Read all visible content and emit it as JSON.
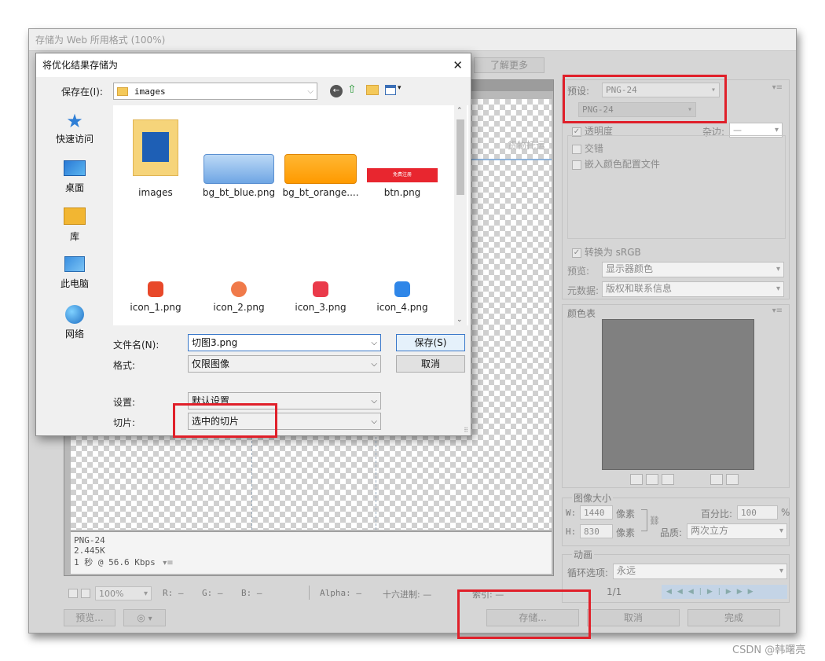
{
  "window": {
    "title": "存储为 Web 所用格式 (100%)",
    "learn_more": "了解更多",
    "canvas_watermark": "货物托运"
  },
  "preview_info": {
    "format": "PNG-24",
    "size": "2.445K",
    "speed": "1 秒 @ 56.6 Kbps"
  },
  "statusbar": {
    "zoom": "100%",
    "r": "R: —",
    "g": "G: —",
    "b": "B: —",
    "alpha": "Alpha: —",
    "hex": "十六进制: —",
    "index": "索引: —"
  },
  "bottom_buttons": {
    "preview": "预览...",
    "save": "存储...",
    "cancel": "取消",
    "done": "完成"
  },
  "settings": {
    "preset_label": "预设:",
    "preset_value": "PNG-24",
    "format_value": "PNG-24",
    "transparency": "透明度",
    "matte_label": "杂边:",
    "matte_value": "—",
    "interlaced": "交错",
    "embed_profile": "嵌入颜色配置文件",
    "convert_srgb": "转换为 sRGB",
    "preview_label": "预览:",
    "preview_value": "显示器颜色",
    "metadata_label": "元数据:",
    "metadata_value": "版权和联系信息",
    "color_table": "颜色表"
  },
  "image_size": {
    "title": "图像大小",
    "w_label": "W:",
    "w_value": "1440",
    "w_unit": "像素",
    "h_label": "H:",
    "h_value": "830",
    "h_unit": "像素",
    "percent_label": "百分比:",
    "percent_value": "100",
    "percent_unit": "%",
    "quality_label": "品质:",
    "quality_value": "两次立方"
  },
  "animation": {
    "title": "动画",
    "loop_label": "循环选项:",
    "loop_value": "永远",
    "frame": "1/1"
  },
  "dialog": {
    "title": "将优化结果存储为",
    "save_in_label": "保存在(I):",
    "save_in_value": "images",
    "nav": [
      {
        "label": "快速访问"
      },
      {
        "label": "桌面"
      },
      {
        "label": "库"
      },
      {
        "label": "此电脑"
      },
      {
        "label": "网络"
      }
    ],
    "files": [
      {
        "name": "images"
      },
      {
        "name": "bg_bt_blue.png"
      },
      {
        "name": "bg_bt_orange...."
      },
      {
        "name": "btn.png",
        "thumb_text": "免费注册"
      },
      {
        "name": "icon_1.png"
      },
      {
        "name": "icon_2.png"
      },
      {
        "name": "icon_3.png"
      },
      {
        "name": "icon_4.png"
      }
    ],
    "filename_label": "文件名(N):",
    "filename_value": "切图3.png",
    "format_label": "格式:",
    "format_value": "仅限图像",
    "save_button": "保存(S)",
    "cancel_button": "取消",
    "settings_label": "设置:",
    "settings_value": "默认设置",
    "slices_label": "切片:",
    "slices_value": "选中的切片",
    "close": "✕"
  },
  "watermark": "CSDN @韩曙亮",
  "colors": {
    "highlight_red": "#e0202a",
    "panel_grey": "#d6d6d6",
    "color_table_fill": "#808080"
  }
}
